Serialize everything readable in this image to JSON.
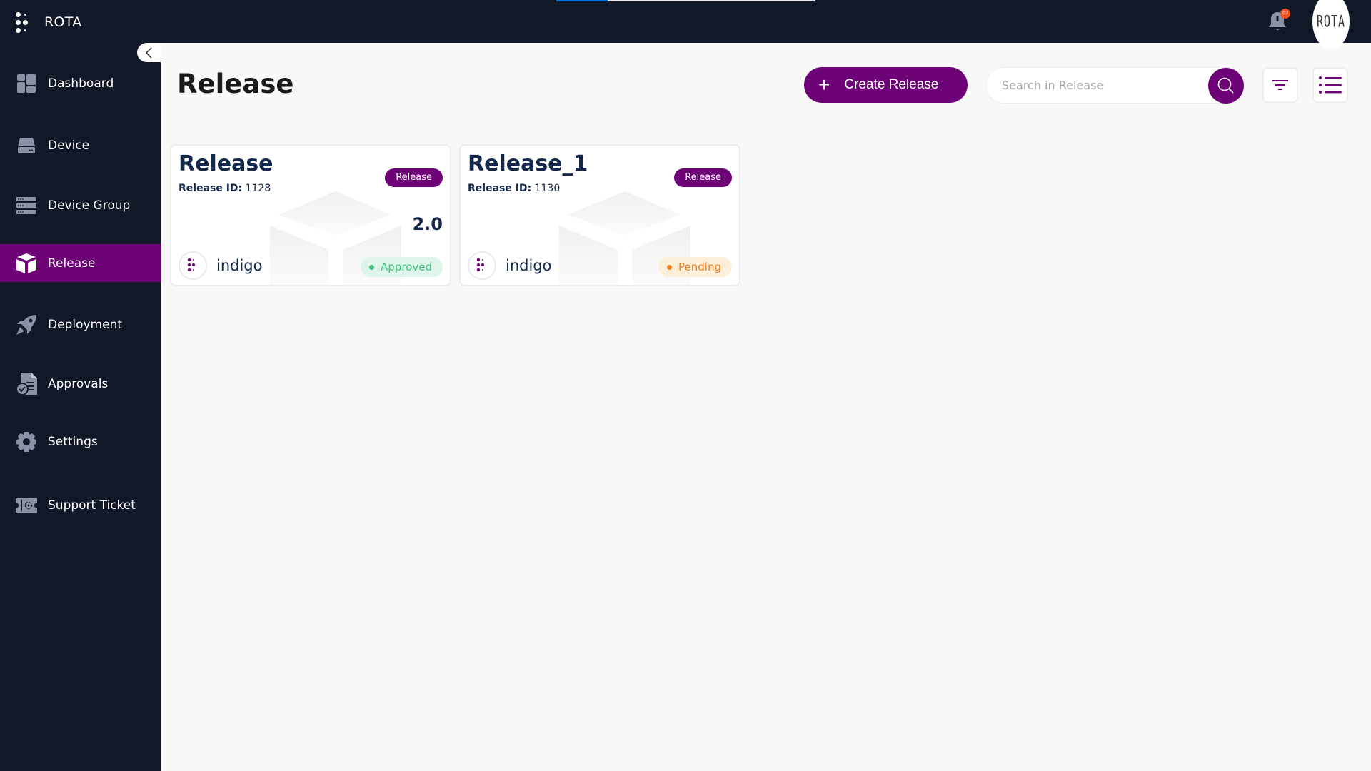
{
  "app": {
    "name": "ROTA",
    "avatar_text": "ROTA",
    "notification_count": "03",
    "loading_progress_percent": 20
  },
  "sidebar": {
    "collapse_label": "<",
    "items": [
      {
        "label": "Dashboard",
        "icon": "dashboard-icon",
        "active": false
      },
      {
        "label": "Device",
        "icon": "device-icon",
        "active": false
      },
      {
        "label": "Device Group",
        "icon": "device-group-icon",
        "active": false
      },
      {
        "label": "Release",
        "icon": "release-box-icon",
        "active": true
      },
      {
        "label": "Deployment",
        "icon": "rocket-icon",
        "active": false
      },
      {
        "label": "Approvals",
        "icon": "approvals-doc-icon",
        "active": false
      },
      {
        "label": "Settings",
        "icon": "gear-icon",
        "active": false
      },
      {
        "label": "Support Ticket",
        "icon": "ticket-icon",
        "active": false
      }
    ]
  },
  "page": {
    "title": "Release",
    "create_button_label": "Create Release",
    "create_button_icon": "+",
    "search_placeholder": "Search in Release",
    "search_value": ""
  },
  "colors": {
    "brand": "#6e0378",
    "sidebar_bg": "#111827",
    "approved": "#3cc17f",
    "pending": "#f27a1a",
    "progress": "#0a6fd8"
  },
  "releases": [
    {
      "name": "Release",
      "id_label": "Release ID:",
      "id": "1128",
      "tag": "Release",
      "version": "2.0",
      "owner": "indigo",
      "status": "Approved"
    },
    {
      "name": "Release_1",
      "id_label": "Release ID:",
      "id": "1130",
      "tag": "Release",
      "version": "",
      "owner": "indigo",
      "status": "Pending"
    }
  ]
}
